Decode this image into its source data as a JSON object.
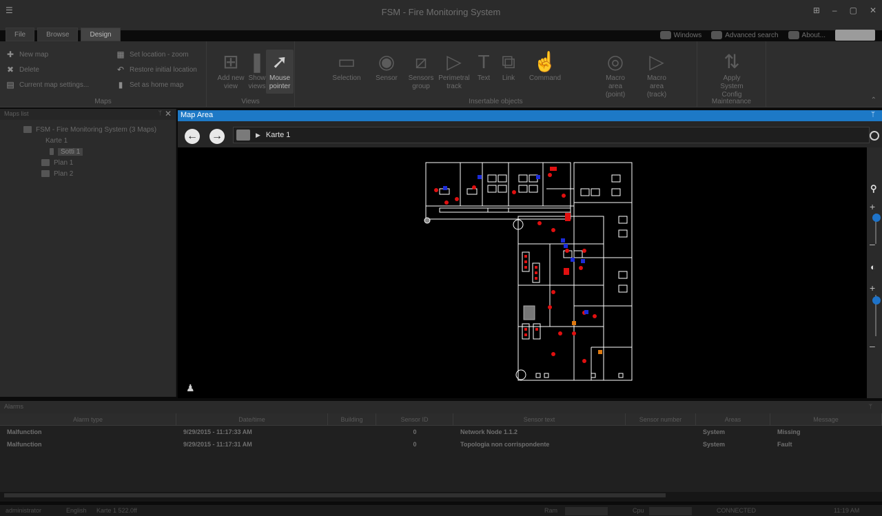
{
  "window": {
    "app_icon": "app-menu-icon",
    "title": "FSM - Fire Monitoring System",
    "controls": [
      "options-icon",
      "minimize-icon",
      "maximize-icon",
      "close-icon"
    ]
  },
  "tabs": [
    {
      "label": "File"
    },
    {
      "label": "Browse"
    },
    {
      "label": "Design"
    }
  ],
  "header_right": {
    "windows": "Windows",
    "search": "Advanced search",
    "about": "About..."
  },
  "ribbon": {
    "maps_group": {
      "label": "Maps",
      "items": [
        {
          "label": "New map",
          "icon": "plus-icon"
        },
        {
          "label": "Delete",
          "icon": "delete-icon"
        },
        {
          "label": "Current map settings...",
          "icon": "settings-icon"
        },
        {
          "label": "Set location - zoom",
          "icon": "location-icon"
        },
        {
          "label": "Restore initial location",
          "icon": "restore-icon"
        },
        {
          "label": "Set as home map",
          "icon": "home-map-icon"
        }
      ]
    },
    "views_group": {
      "label": "Views",
      "items": [
        {
          "label": "Add new view"
        },
        {
          "label": "Show views"
        },
        {
          "label": "Mouse pointer"
        }
      ]
    },
    "insertable_group": {
      "label": "Insertable objects",
      "items": [
        {
          "label": "Selection"
        },
        {
          "label": "Sensor"
        },
        {
          "label": "Sensors group"
        },
        {
          "label": "Perimetral track"
        },
        {
          "label": "Text"
        },
        {
          "label": "Link"
        },
        {
          "label": "Command"
        },
        {
          "label": "Macro area (point)"
        },
        {
          "label": "Macro area (track)"
        }
      ]
    },
    "maintenance_group": {
      "label": "Maintenance",
      "items": [
        {
          "label": "Apply System Config"
        }
      ]
    }
  },
  "maps_panel": {
    "title": "Maps list",
    "tree": [
      {
        "label": "FSM - Fire Monitoring System (3 Maps)",
        "level": 0
      },
      {
        "label": "Karte 1",
        "level": 1
      },
      {
        "label": "Sotti 1",
        "level": 2,
        "selected": true
      },
      {
        "label": "Plan 1",
        "level": 1
      },
      {
        "label": "Plan 2",
        "level": 1
      }
    ]
  },
  "map_area": {
    "title": "Map Area",
    "breadcrumb": "Karte 1"
  },
  "alarms": {
    "title": "Alarms",
    "columns": [
      "Alarm type",
      "Date/time",
      "Building",
      "Sensor ID",
      "Sensor text",
      "Sensor number",
      "Areas",
      "Message"
    ],
    "rows": [
      [
        "Malfunction",
        "9/29/2015 - 11:17:33 AM",
        "",
        "0",
        "Network Node 1.1.2",
        "",
        "System",
        "Missing"
      ],
      [
        "Malfunction",
        "9/29/2015 - 11:17:31 AM",
        "",
        "0",
        "Topologia non corrispondente",
        "",
        "System",
        "Fault"
      ]
    ]
  },
  "statusbar": {
    "user": "administrator",
    "lang": "English",
    "map": "Karte 1 522.0ff",
    "ram_label": "Ram",
    "cpu_label": "Cpu",
    "status": "CONNECTED",
    "time": "11:19 AM"
  },
  "colors": {
    "accent": "#1d79c6",
    "alarm_red": "#e01010",
    "sensor_blue": "#1c2cd8"
  }
}
